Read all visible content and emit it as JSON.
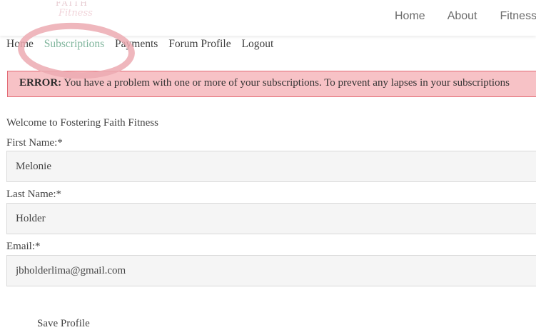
{
  "header": {
    "logo_line1": "FAITH",
    "logo_line2": "Fitness",
    "nav": [
      "Home",
      "About",
      "Fitness"
    ]
  },
  "account_nav": {
    "items": [
      "Home",
      "Subscriptions",
      "Payments",
      "Forum Profile",
      "Logout"
    ],
    "active": "Subscriptions"
  },
  "error": {
    "label": "ERROR:",
    "message": "You have a problem with one or more of your subscriptions. To prevent any lapses in your subscriptions"
  },
  "form": {
    "welcome": "Welcome to Fostering Faith Fitness",
    "first_name_label": "First Name:*",
    "first_name_value": "Melonie",
    "last_name_label": "Last Name:*",
    "last_name_value": "Holder",
    "email_label": "Email:*",
    "email_value": "jbholderlima@gmail.com",
    "save_label": "Save Profile"
  },
  "colors": {
    "active_link": "#7fb59c",
    "error_background": "#f7c2c6",
    "error_border": "#e36b75",
    "highlight": "#ecaab2"
  }
}
